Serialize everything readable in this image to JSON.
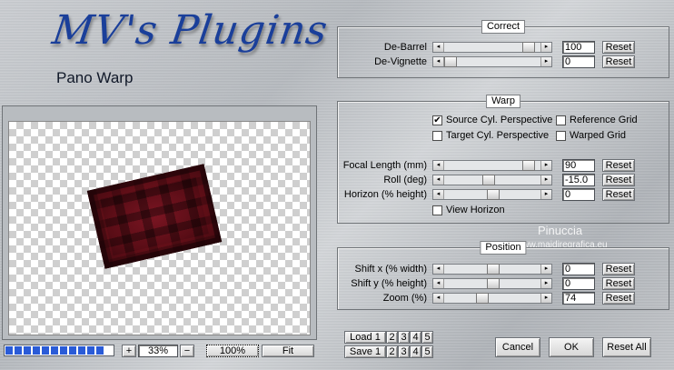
{
  "header": {
    "logo_text": "MV's Plugins",
    "subtitle": "Pano Warp"
  },
  "correct": {
    "title": "Correct",
    "rows": [
      {
        "label": "De-Barrel",
        "value": "100",
        "level": 0.92
      },
      {
        "label": "De-Vignette",
        "value": "0",
        "level": 0.0
      }
    ]
  },
  "warp": {
    "title": "Warp",
    "checks": {
      "source_cyl": {
        "label": "Source Cyl. Perspective",
        "checked": true
      },
      "reference_grid": {
        "label": "Reference Grid",
        "checked": false
      },
      "target_cyl": {
        "label": "Target Cyl. Perspective",
        "checked": false
      },
      "warped_grid": {
        "label": "Warped Grid",
        "checked": false
      },
      "view_horizon": {
        "label": "View Horizon",
        "checked": false
      }
    },
    "rows": [
      {
        "label": "Focal Length (mm)",
        "value": "90",
        "level": 0.92
      },
      {
        "label": "Roll (deg)",
        "value": "-15.0",
        "level": 0.45
      },
      {
        "label": "Horizon (% height)",
        "value": "0",
        "level": 0.5
      }
    ]
  },
  "position": {
    "title": "Position",
    "rows": [
      {
        "label": "Shift x (% width)",
        "value": "0",
        "level": 0.5
      },
      {
        "label": "Shift y (% height)",
        "value": "0",
        "level": 0.5
      },
      {
        "label": "Zoom (%)",
        "value": "74",
        "level": 0.37
      }
    ]
  },
  "reset_label": "Reset",
  "watermark": {
    "name": "Pinuccia",
    "site": "www.maidiregrafica.eu"
  },
  "zoom": {
    "plus": "+",
    "minus": "−",
    "value": "33%",
    "actual": "100%",
    "fit": "Fit",
    "progress_segments": 11
  },
  "presets": {
    "load_label": "Load 1",
    "save_label": "Save 1",
    "slots": [
      "2",
      "3",
      "4",
      "5"
    ]
  },
  "actions": {
    "cancel": "Cancel",
    "ok": "OK",
    "reset_all": "Reset All"
  },
  "icons": {
    "arrow_left": "◂",
    "arrow_right": "▸",
    "check_mark": "✔"
  }
}
